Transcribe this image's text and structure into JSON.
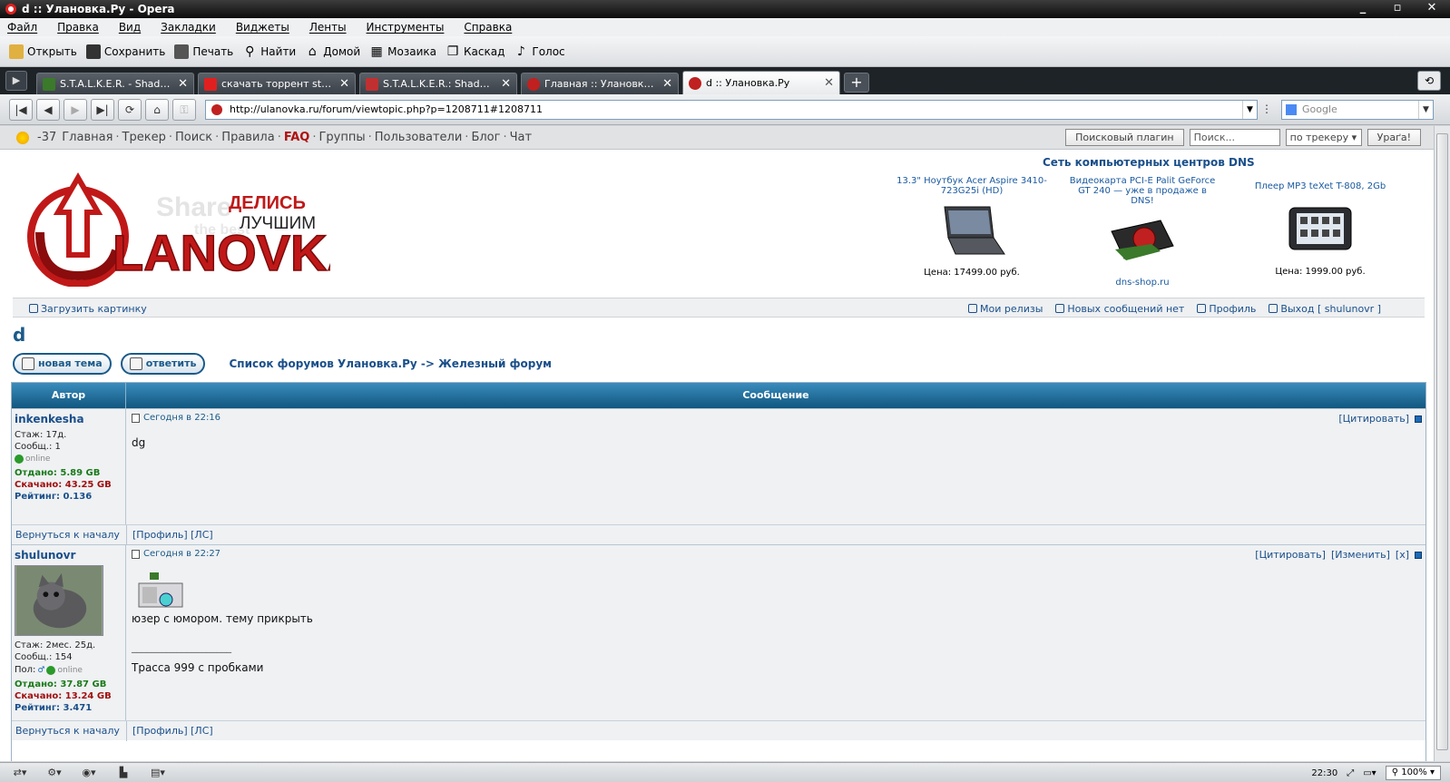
{
  "window": {
    "title": "d :: Улановка.Ру - Opera",
    "buttons": [
      "_",
      "▫",
      "✕"
    ]
  },
  "menu": [
    "Файл",
    "Правка",
    "Вид",
    "Закладки",
    "Виджеты",
    "Ленты",
    "Инструменты",
    "Справка"
  ],
  "toolbar": {
    "open": "Открыть",
    "save": "Сохранить",
    "print": "Печать",
    "find": "Найти",
    "home": "Домой",
    "tile": "Мозаика",
    "cascade": "Каскад",
    "voice": "Голос"
  },
  "tabs": [
    {
      "label": "S.T.A.L.K.E.R. - Shadow ...",
      "color": "#3a7a2a"
    },
    {
      "label": "скачать торрент stalke...",
      "color": "#e02020"
    },
    {
      "label": "S.T.A.L.K.E.R.: Shadow o...",
      "color": "#c03030"
    },
    {
      "label": "Главная :: Улановка.Ру",
      "color": "#c02020"
    },
    {
      "label": "d :: Улановка.Ру",
      "color": "#c02020"
    }
  ],
  "address": {
    "url": "http://ulanovka.ru/forum/viewtopic.php?p=1208711#1208711",
    "search_placeholder": "Google"
  },
  "sitenav": {
    "temp": "-37",
    "links": [
      "Главная",
      "Трекер",
      "Поиск",
      "Правила",
      "FAQ",
      "Группы",
      "Пользователи",
      "Блог",
      "Чат"
    ],
    "plugin_button": "Поисковый плагин",
    "search_placeholder": "Поиск...",
    "search_scope": "по трекеру",
    "go_button": "Ураґа!"
  },
  "logo": {
    "share": "Share",
    "best": "the best",
    "delis": "ДЕЛИСЬ",
    "best_ru": "ЛУЧШИМ",
    "name": "LANOVKA"
  },
  "dns": {
    "title": "Сеть компьютерных центров DNS",
    "items": [
      {
        "name": "13.3\" Ноутбук Acer Aspire 3410-723G25i (HD)",
        "price": "Цена: 17499.00 руб."
      },
      {
        "name": "Видеокарта PCI-E Palit GeForce GT 240 — уже в продаже в DNS!",
        "price": "dns-shop.ru"
      },
      {
        "name": "Плеер MP3 teXet T-808, 2Gb",
        "price": "Цена: 1999.00 руб."
      }
    ]
  },
  "userbar": {
    "upload": "Загрузить картинку",
    "releases": "Мои релизы",
    "new_msgs": "Новых сообщений нет",
    "profile": "Профиль",
    "logout": "Выход [ shulunovr ]"
  },
  "topic": {
    "title": "d",
    "new_topic": "новая тема",
    "reply": "ответить",
    "crumbs": "Список форумов Улановка.Ру -> Железный форум"
  },
  "table": {
    "col_author": "Автор",
    "col_message": "Сообщение"
  },
  "posts": [
    {
      "author": "inkenkesha",
      "lines": [
        "Стаж: 17д.",
        "Сообщ.: 1"
      ],
      "online": "online",
      "up": "Отдано: 5.89 GB",
      "down": "Скачано: 43.25 GB",
      "rating": "Рейтинг: 0.136",
      "time": "Сегодня в 22:16",
      "actions": [
        "[Цитировать]"
      ],
      "text": "dg",
      "back": "Вернуться к началу",
      "links": "[Профиль] [ЛС]"
    },
    {
      "author": "shulunovr",
      "lines": [
        "Стаж: 2мес. 25д.",
        "Сообщ.: 154"
      ],
      "gender": "Пол:",
      "online": "online",
      "up": "Отдано: 37.87 GB",
      "down": "Скачано: 13.24 GB",
      "rating": "Рейтинг: 3.471",
      "time": "Сегодня в 22:27",
      "actions": [
        "[Цитировать]",
        "[Изменить]",
        "[x]"
      ],
      "text": "юзер с юмором. тему прикрыть",
      "sig_line": "____________________",
      "signature": "Трасса 999 с пробками",
      "back": "Вернуться к началу",
      "links": "[Профиль] [ЛС]"
    }
  ],
  "status": {
    "clock": "22:30",
    "zoom": "100%"
  }
}
